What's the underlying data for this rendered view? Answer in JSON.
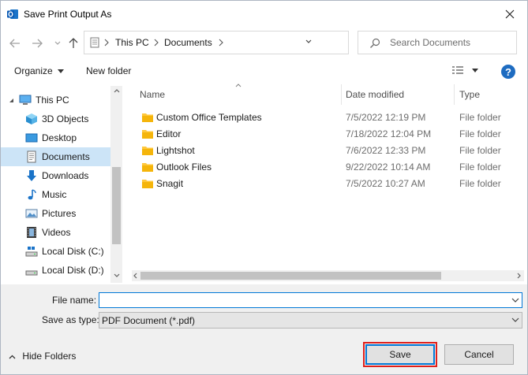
{
  "window": {
    "title": "Save Print Output As"
  },
  "breadcrumb": {
    "items": [
      "This PC",
      "Documents"
    ]
  },
  "search": {
    "placeholder": "Search Documents"
  },
  "toolbar": {
    "organize": "Organize",
    "new_folder": "New folder",
    "help": "?"
  },
  "nav": {
    "items": [
      {
        "label": "This PC",
        "icon": "pc-icon"
      },
      {
        "label": "3D Objects",
        "icon": "cube-icon"
      },
      {
        "label": "Desktop",
        "icon": "desktop-icon"
      },
      {
        "label": "Documents",
        "icon": "document-icon",
        "selected": true
      },
      {
        "label": "Downloads",
        "icon": "download-icon"
      },
      {
        "label": "Music",
        "icon": "music-icon"
      },
      {
        "label": "Pictures",
        "icon": "picture-icon"
      },
      {
        "label": "Videos",
        "icon": "video-icon"
      },
      {
        "label": "Local Disk (C:)",
        "icon": "drive-icon"
      },
      {
        "label": "Local Disk (D:)",
        "icon": "drive-icon"
      }
    ]
  },
  "columns": {
    "name": "Name",
    "date": "Date modified",
    "type": "Type"
  },
  "files": [
    {
      "name": "Custom Office Templates",
      "date": "7/5/2022 12:19 PM",
      "type": "File folder"
    },
    {
      "name": "Editor",
      "date": "7/18/2022 12:04 PM",
      "type": "File folder"
    },
    {
      "name": "Lightshot",
      "date": "7/6/2022 12:33 PM",
      "type": "File folder"
    },
    {
      "name": "Outlook Files",
      "date": "9/22/2022 10:14 AM",
      "type": "File folder"
    },
    {
      "name": "Snagit",
      "date": "7/5/2022 10:27 AM",
      "type": "File folder"
    }
  ],
  "form": {
    "file_name_label": "File name:",
    "file_name_value": "",
    "save_type_label": "Save as type:",
    "save_type_value": "PDF Document (*.pdf)"
  },
  "footer": {
    "hide_folders": "Hide Folders",
    "save": "Save",
    "cancel": "Cancel"
  },
  "colors": {
    "accent": "#0078d7",
    "highlight": "#e0201b",
    "selection": "#cce4f7",
    "folder": "#ffc83d"
  }
}
